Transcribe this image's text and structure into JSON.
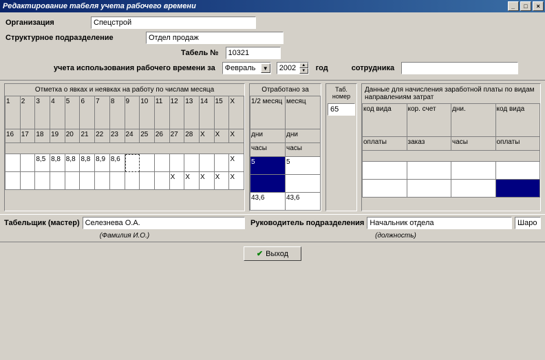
{
  "title": "Редактирование табеля учета рабочего времени",
  "form": {
    "org_label": "Организация",
    "org_value": "Спецстрой",
    "dept_label": "Структурное подразделение",
    "dept_value": "Отдел продаж",
    "tabel_label": "Табель №",
    "tabel_value": "10321",
    "period_label": "учета использования рабочего времени за",
    "month_value": "Февраль",
    "year_value": "2002",
    "year_suffix": "год",
    "employee_label": "сотрудника",
    "employee_value": ""
  },
  "panel_marks": {
    "header": "Отметка о явках и неявках на работу по числам месяца",
    "row1": [
      "1",
      "2",
      "3",
      "4",
      "5",
      "6",
      "7",
      "8",
      "9",
      "10",
      "11",
      "12",
      "13",
      "14",
      "15",
      "X"
    ],
    "row2": [
      "16",
      "17",
      "18",
      "19",
      "20",
      "21",
      "22",
      "23",
      "24",
      "25",
      "26",
      "27",
      "28",
      "X",
      "X",
      "X"
    ],
    "row3": [
      "",
      "",
      "8,5",
      "8,8",
      "8,8",
      "8,8",
      "8,9",
      "8,6",
      "",
      "",
      "",
      "",
      "",
      "",
      "",
      "X"
    ],
    "row4": [
      "",
      "",
      "",
      "",
      "",
      "",
      "",
      "",
      "",
      "",
      "",
      "X",
      "X",
      "X",
      "X",
      "X"
    ]
  },
  "panel_worked": {
    "header": "Отработано за",
    "r1": [
      "1/2 месяц",
      "месяц"
    ],
    "r2": [
      "дни",
      "дни"
    ],
    "r3": [
      "часы",
      "часы"
    ],
    "r4": [
      "5",
      "5"
    ],
    "r5": [
      "",
      ""
    ],
    "r6": [
      "43,6",
      "43,6"
    ]
  },
  "panel_tabno": {
    "header": "Таб. номер",
    "value": "65"
  },
  "panel_pay": {
    "header": "Данные для начисления заработной платы по видам направлениям затрат",
    "r1": [
      "код вида",
      "кор. счет",
      "дни.",
      "код вида"
    ],
    "r2": [
      "оплаты",
      "заказ",
      "часы",
      "оплаты"
    ],
    "r3": [
      "",
      "",
      "",
      ""
    ],
    "r4": [
      "",
      "",
      "",
      ""
    ]
  },
  "bottom": {
    "tabelchik_label": "Табельщик (мастер)",
    "tabelchik_value": "Селезнева О.А.",
    "tabelchik_hint": "(Фамилия И.О.)",
    "ruk_label": "Руководитель подразделения",
    "ruk_value": "Начальник отдела",
    "ruk_hint": "(должность)",
    "extra": "Шаро"
  },
  "exit_btn": "Выход"
}
